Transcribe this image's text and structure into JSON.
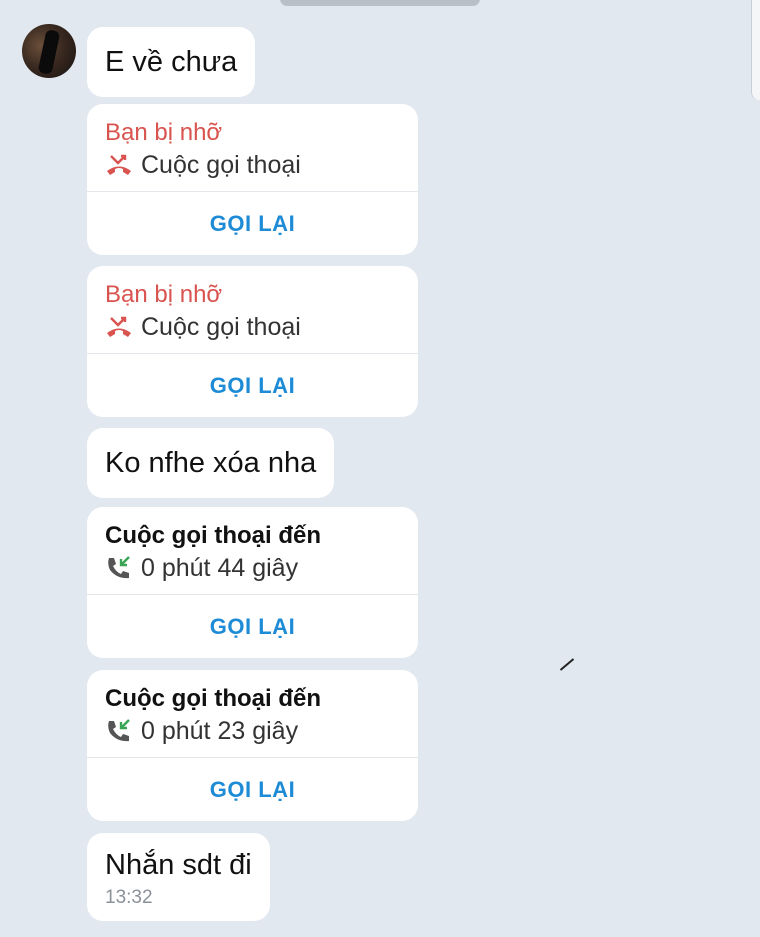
{
  "messages": [
    {
      "type": "text",
      "text": "E về chưa"
    },
    {
      "type": "missed_call",
      "title": "Bạn bị nhỡ",
      "subtitle": "Cuộc gọi thoại",
      "action": "GỌI LẠI"
    },
    {
      "type": "missed_call",
      "title": "Bạn bị nhỡ",
      "subtitle": "Cuộc gọi thoại",
      "action": "GỌI LẠI"
    },
    {
      "type": "text",
      "text": "Ko nfhe xóa nha"
    },
    {
      "type": "incoming_call",
      "title": "Cuộc gọi thoại đến",
      "subtitle": "0 phút 44 giây",
      "action": "GỌI LẠI"
    },
    {
      "type": "incoming_call",
      "title": "Cuộc gọi thoại đến",
      "subtitle": "0 phút 23 giây",
      "action": "GỌI LẠI"
    },
    {
      "type": "text",
      "text": "Nhắn sdt đi",
      "time": "13:32"
    }
  ],
  "colors": {
    "missed": "#d9534f",
    "incoming_icon": "#3aa655",
    "action": "#1e8bd6",
    "background": "#e2e8f0"
  }
}
